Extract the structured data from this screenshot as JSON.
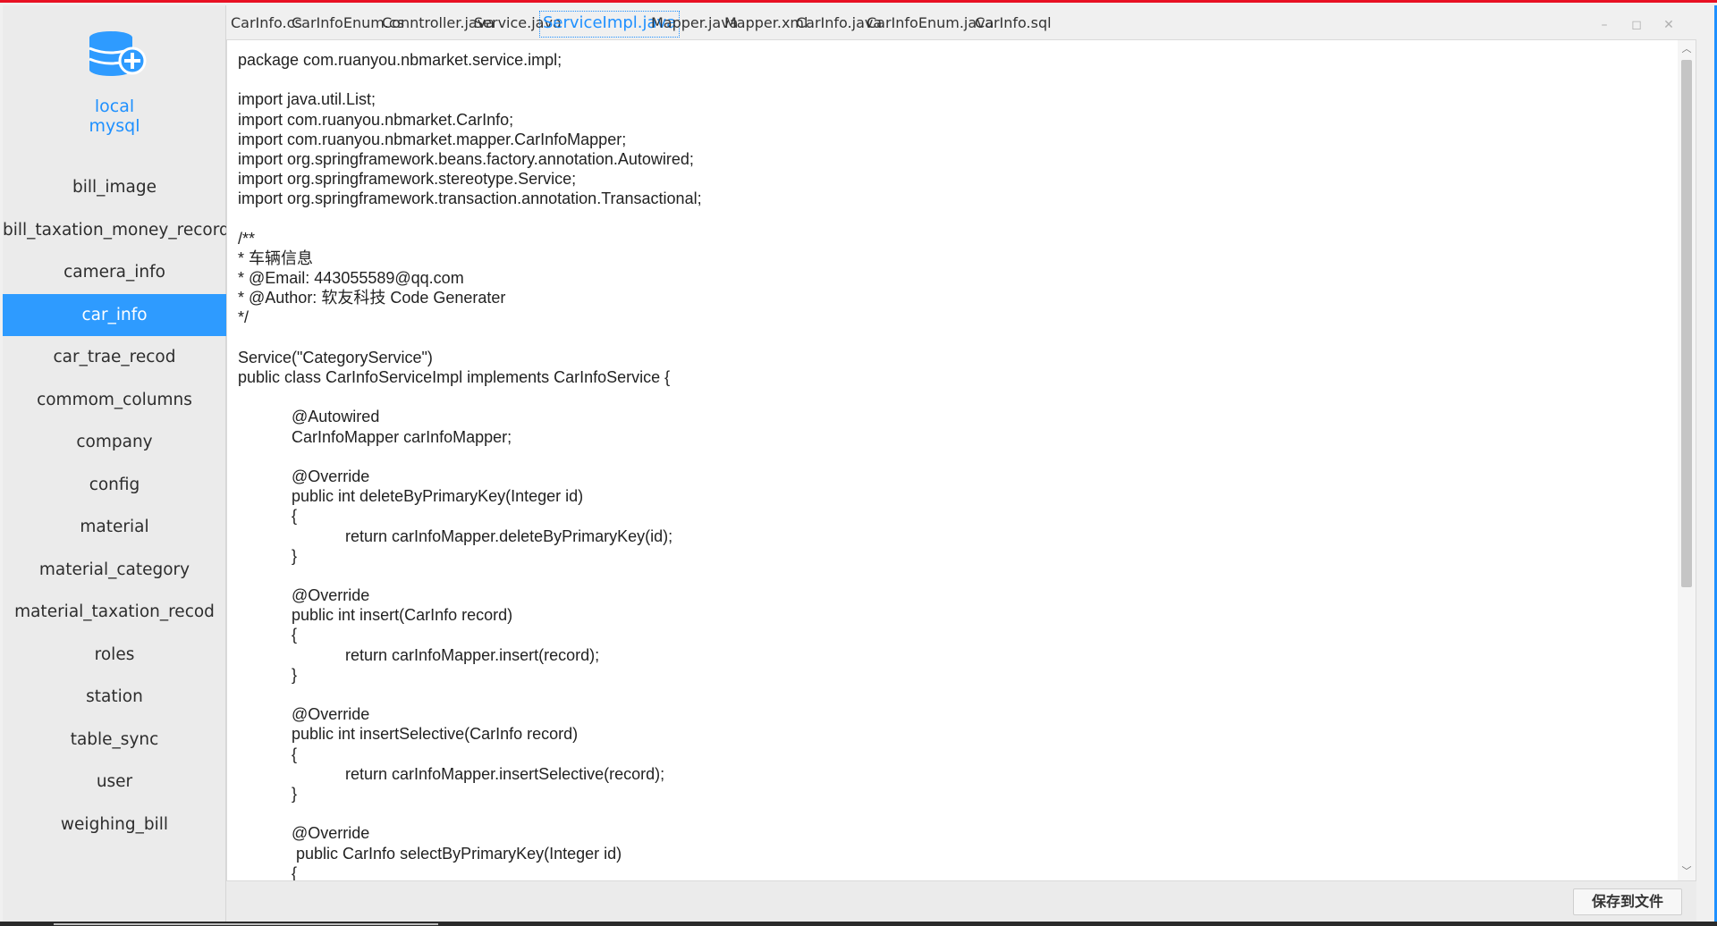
{
  "connection": {
    "line1": "local",
    "line2": "mysql"
  },
  "tables": [
    "bill_image",
    "bill_taxation_money_record",
    "camera_info",
    "car_info",
    "car_trae_recod",
    "commom_columns",
    "company",
    "config",
    "material",
    "material_category",
    "material_taxation_recod",
    "roles",
    "station",
    "table_sync",
    "user",
    "weighing_bill"
  ],
  "active_table": "car_info",
  "tabs": [
    "CarInfo.cs",
    "CarInfoEnum.cs",
    "Conntroller.java",
    "Service.java",
    "ServiceImpl.java",
    "Mapper.java",
    "Mapper.xml",
    "CarInfo.java",
    "CarInfoEnum.java",
    "CarInfo.sql"
  ],
  "active_tab": "ServiceImpl.java",
  "window_controls": {
    "minimize": "–",
    "maximize": "◻",
    "close": "✕"
  },
  "code": [
    "package com.ruanyou.nbmarket.service.impl;",
    "",
    "import java.util.List;",
    "import com.ruanyou.nbmarket.CarInfo;",
    "import com.ruanyou.nbmarket.mapper.CarInfoMapper;",
    "import org.springframework.beans.factory.annotation.Autowired;",
    "import org.springframework.stereotype.Service;",
    "import org.springframework.transaction.annotation.Transactional;",
    "",
    "/**",
    "* 车辆信息",
    "* @Email: 443055589@qq.com",
    "* @Author: 软友科技 Code Generater",
    "*/",
    "",
    "Service(\"CategoryService\")",
    "public class CarInfoServiceImpl implements CarInfoService {",
    "",
    "            @Autowired",
    "            CarInfoMapper carInfoMapper;",
    "",
    "            @Override",
    "            public int deleteByPrimaryKey(Integer id)",
    "            {",
    "                        return carInfoMapper.deleteByPrimaryKey(id);",
    "            }",
    "",
    "            @Override",
    "            public int insert(CarInfo record)",
    "            {",
    "                        return carInfoMapper.insert(record);",
    "            }",
    "",
    "            @Override",
    "            public int insertSelective(CarInfo record)",
    "            {",
    "                        return carInfoMapper.insertSelective(record);",
    "            }",
    "",
    "            @Override",
    "             public CarInfo selectByPrimaryKey(Integer id)",
    "            {"
  ],
  "footer": {
    "save_label": "保存到文件"
  },
  "colors": {
    "accent": "#1e90ff",
    "active_row": "#2e9bff",
    "window_border": "#e81123"
  }
}
